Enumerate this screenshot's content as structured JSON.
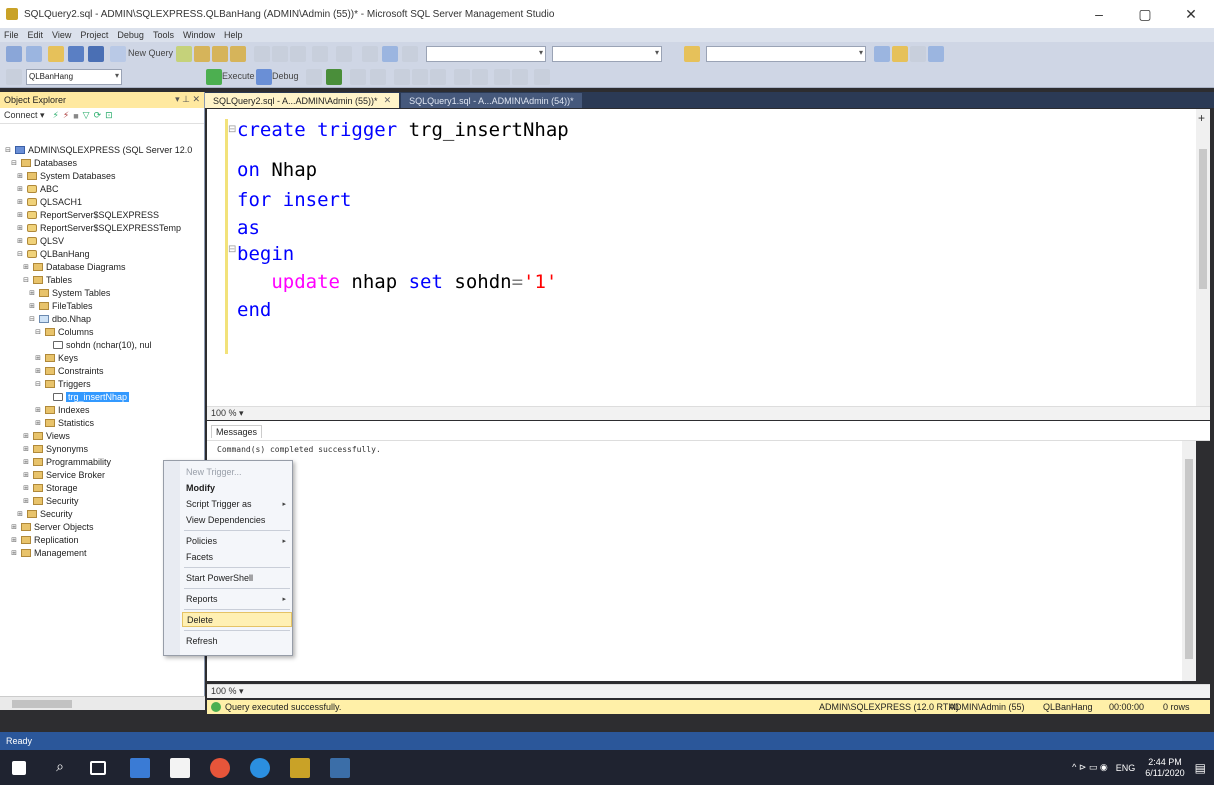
{
  "window": {
    "title": "SQLQuery2.sql - ADMIN\\SQLEXPRESS.QLBanHang (ADMIN\\Admin (55))* - Microsoft SQL Server Management Studio",
    "minimize": "–",
    "maximize": "▢",
    "close": "✕"
  },
  "menu": [
    "File",
    "Edit",
    "View",
    "Project",
    "Debug",
    "Tools",
    "Window",
    "Help"
  ],
  "toolbar": {
    "new_query": "New Query",
    "database_combo": "QLBanHang",
    "execute": "Execute",
    "debug": "Debug"
  },
  "object_explorer": {
    "title": "Object Explorer",
    "pin": "▾ ⊥ ✕",
    "connect_label": "Connect ▾",
    "nodes": [
      {
        "label": "ADMIN\\SQLEXPRESS (SQL Server 12.0",
        "exp": "⊟",
        "icon": "srv"
      },
      {
        "label": "Databases",
        "exp": "⊟",
        "icon": "folder"
      },
      {
        "label": "System Databases",
        "exp": "⊞",
        "icon": "folder"
      },
      {
        "label": "ABC",
        "exp": "⊞",
        "icon": "db"
      },
      {
        "label": "QLSACH1",
        "exp": "⊞",
        "icon": "db"
      },
      {
        "label": "ReportServer$SQLEXPRESS",
        "exp": "⊞",
        "icon": "db"
      },
      {
        "label": "ReportServer$SQLEXPRESSTemp",
        "exp": "⊞",
        "icon": "db"
      },
      {
        "label": "QLSV",
        "exp": "⊞",
        "icon": "db"
      },
      {
        "label": "QLBanHang",
        "exp": "⊟",
        "icon": "db"
      },
      {
        "label": "Database Diagrams",
        "exp": "⊞",
        "icon": "folder"
      },
      {
        "label": "Tables",
        "exp": "⊟",
        "icon": "folder"
      },
      {
        "label": "System Tables",
        "exp": "⊞",
        "icon": "folder"
      },
      {
        "label": "FileTables",
        "exp": "⊞",
        "icon": "folder"
      },
      {
        "label": "dbo.Nhap",
        "exp": "⊟",
        "icon": "tbl"
      },
      {
        "label": "Columns",
        "exp": "⊟",
        "icon": "folder"
      },
      {
        "label": "sohdn (nchar(10), nul",
        "exp": "",
        "icon": "col"
      },
      {
        "label": "Keys",
        "exp": "⊞",
        "icon": "folder"
      },
      {
        "label": "Constraints",
        "exp": "⊞",
        "icon": "folder"
      },
      {
        "label": "Triggers",
        "exp": "⊟",
        "icon": "folder"
      },
      {
        "label": "trg_insertNhap",
        "exp": "",
        "icon": "col",
        "selected": true
      },
      {
        "label": "Indexes",
        "exp": "⊞",
        "icon": "folder"
      },
      {
        "label": "Statistics",
        "exp": "⊞",
        "icon": "folder"
      },
      {
        "label": "Views",
        "exp": "⊞",
        "icon": "folder"
      },
      {
        "label": "Synonyms",
        "exp": "⊞",
        "icon": "folder"
      },
      {
        "label": "Programmability",
        "exp": "⊞",
        "icon": "folder"
      },
      {
        "label": "Service Broker",
        "exp": "⊞",
        "icon": "folder"
      },
      {
        "label": "Storage",
        "exp": "⊞",
        "icon": "folder"
      },
      {
        "label": "Security",
        "exp": "⊞",
        "icon": "folder"
      },
      {
        "label": "Security",
        "exp": "⊞",
        "icon": "folder"
      },
      {
        "label": "Server Objects",
        "exp": "⊞",
        "icon": "folder"
      },
      {
        "label": "Replication",
        "exp": "⊞",
        "icon": "folder"
      },
      {
        "label": "Management",
        "exp": "⊞",
        "icon": "folder"
      }
    ]
  },
  "tabs": [
    {
      "label": "SQLQuery2.sql - A...ADMIN\\Admin (55))*",
      "close": "✕",
      "active": true
    },
    {
      "label": "SQLQuery1.sql - A...ADMIN\\Admin (54))*",
      "close": "",
      "active": false
    }
  ],
  "editor": {
    "lines": [
      [
        {
          "t": "create trigger",
          "c": "kw"
        },
        {
          "t": " trg_insertNhap",
          "c": ""
        }
      ],
      [
        {
          "t": "on",
          "c": "kw"
        },
        {
          "t": " Nhap",
          "c": ""
        }
      ],
      [
        {
          "t": "for insert",
          "c": "kw"
        }
      ],
      [
        {
          "t": "as",
          "c": "kw"
        }
      ],
      [
        {
          "t": "begin",
          "c": "kw"
        }
      ],
      [
        {
          "t": "   ",
          "c": ""
        },
        {
          "t": "update",
          "c": "fn"
        },
        {
          "t": " nhap ",
          "c": ""
        },
        {
          "t": "set",
          "c": "kw"
        },
        {
          "t": " sohdn",
          "c": ""
        },
        {
          "t": "=",
          "c": "op"
        },
        {
          "t": "'1'",
          "c": "str"
        }
      ],
      [
        {
          "t": "end",
          "c": "kw"
        }
      ]
    ]
  },
  "zoom_editor": "100 % ▾",
  "results": {
    "tab_label": "Messages",
    "message": "Command(s) completed successfully."
  },
  "zoom_results": "100 % ▾",
  "query_status": {
    "text": "Query executed successfully.",
    "server": "ADMIN\\SQLEXPRESS (12.0 RTM)",
    "user": "ADMIN\\Admin (55)",
    "database": "QLBanHang",
    "time": "00:00:00",
    "rows": "0 rows"
  },
  "status": "Ready",
  "context_menu": {
    "items": [
      {
        "label": "New Trigger...",
        "disabled": true
      },
      {
        "label": "Modify",
        "bold": true
      },
      {
        "label": "Script Trigger as",
        "sub": "▸"
      },
      {
        "label": "View Dependencies"
      },
      {
        "sep": true
      },
      {
        "label": "Policies",
        "sub": "▸"
      },
      {
        "label": "Facets"
      },
      {
        "sep": true
      },
      {
        "label": "Start PowerShell"
      },
      {
        "sep": true
      },
      {
        "label": "Reports",
        "sub": "▸"
      },
      {
        "sep": true
      },
      {
        "label": "Delete",
        "highlight": true
      },
      {
        "sep": true
      },
      {
        "label": "Refresh"
      }
    ]
  },
  "taskbar": {
    "time": "2:44 PM",
    "date": "6/11/2020",
    "lang": "ENG",
    "tray": "^ ⊳ ▭ ◉"
  }
}
